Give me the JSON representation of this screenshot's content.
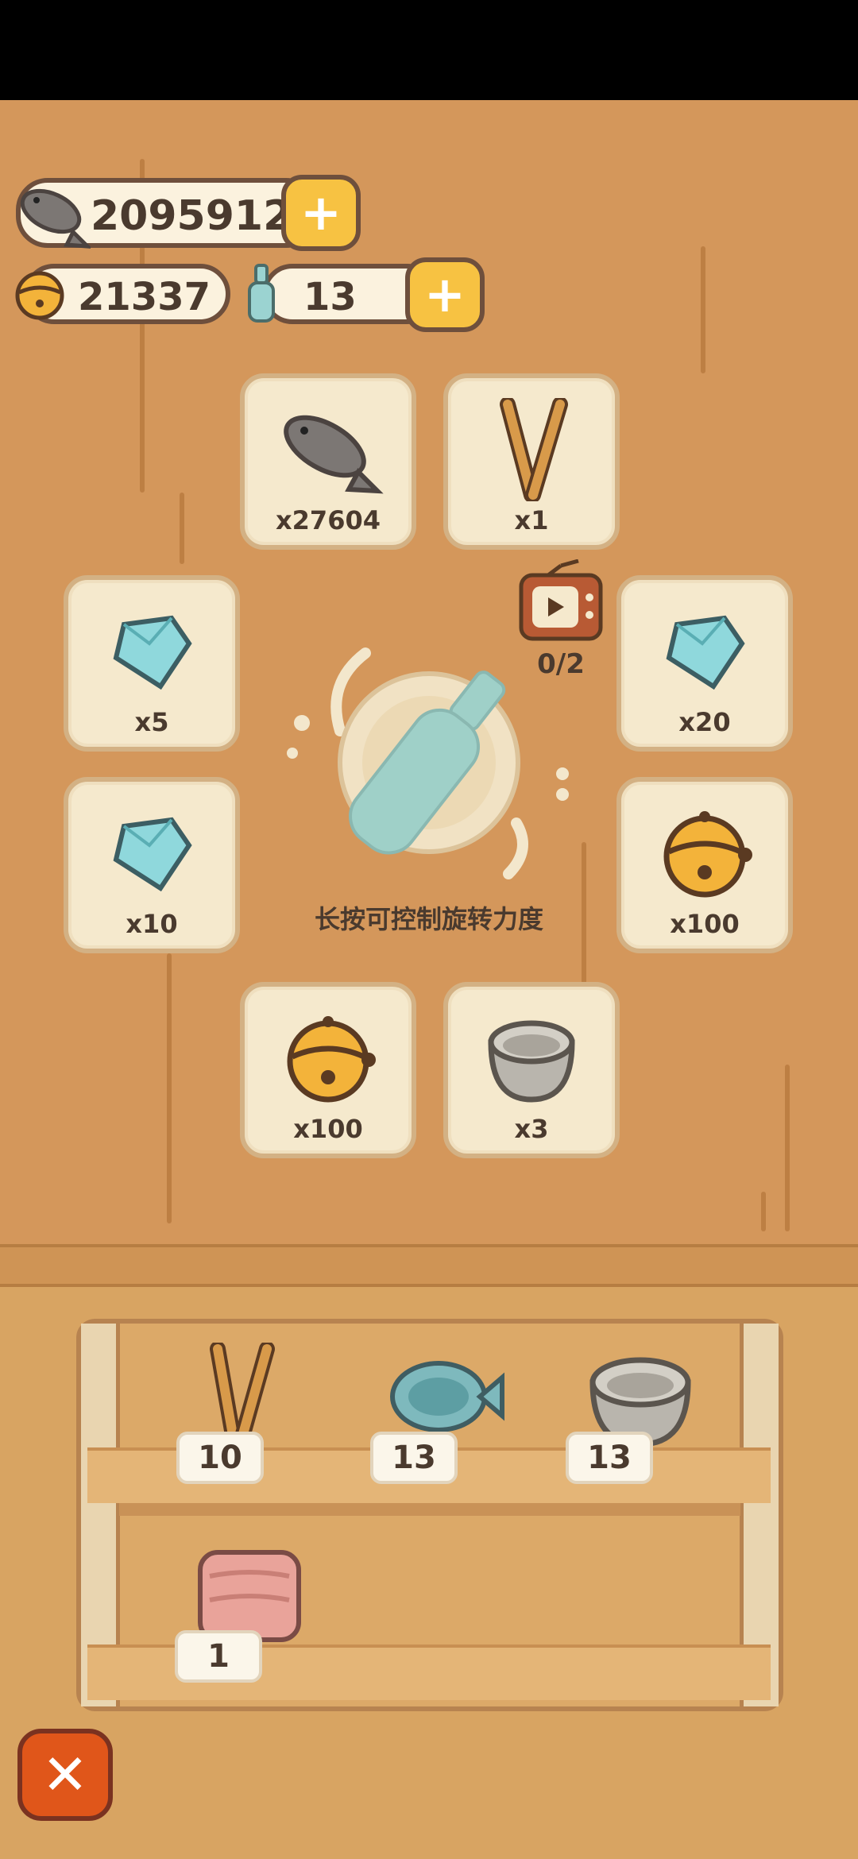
{
  "currency": {
    "fish_amount": "2095912",
    "bell_amount": "21337",
    "bottle_amount": "13"
  },
  "prizes": [
    {
      "icon": "fish-icon",
      "qty": "x27604"
    },
    {
      "icon": "chopsticks-icon",
      "qty": "x1"
    },
    {
      "icon": "diamond-icon",
      "qty": "x5"
    },
    {
      "icon": "diamond-icon",
      "qty": "x20"
    },
    {
      "icon": "diamond-icon",
      "qty": "x10"
    },
    {
      "icon": "bell-icon",
      "qty": "x100"
    },
    {
      "icon": "bell-icon",
      "qty": "x100"
    },
    {
      "icon": "bowl-icon",
      "qty": "x3"
    }
  ],
  "ad": {
    "icon": "tv-icon",
    "count": "0/2"
  },
  "hint_text": "长按可控制旋转力度",
  "shelf": [
    {
      "icon": "chopsticks-icon",
      "count": "10"
    },
    {
      "icon": "fish-plate-icon",
      "count": "13"
    },
    {
      "icon": "bowl-icon",
      "count": "13"
    },
    {
      "icon": "towel-icon",
      "count": "1"
    }
  ],
  "colors": {
    "accent": "#f7c242",
    "wall": "#d4975b",
    "close": "#e0561a"
  }
}
